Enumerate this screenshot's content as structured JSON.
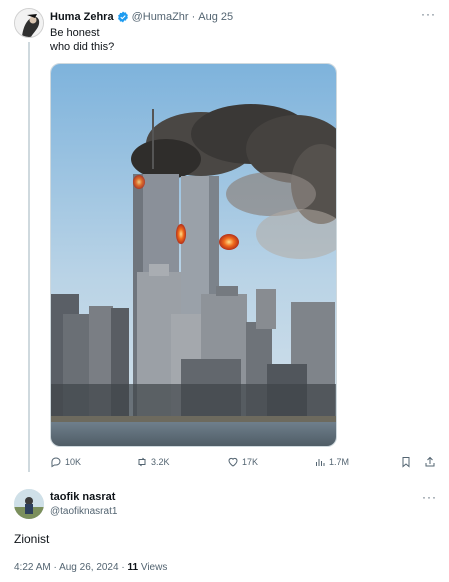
{
  "post": {
    "author_name": "Huma Zehra",
    "author_handle": "@HumaZhr",
    "separator": "·",
    "date": "Aug 25",
    "text_line1": "Be honest",
    "text_line2": "who did this?",
    "more_label": "···",
    "verified_icon": "verified-badge-icon",
    "image_alt": "Photo of the World Trade Center towers with smoke and fire",
    "actions": {
      "replies": "10K",
      "reposts": "3.2K",
      "likes": "17K",
      "views": "1.7M"
    },
    "colors": {
      "accent": "#1d9bf0",
      "muted": "#536471"
    }
  },
  "reply": {
    "author_name": "taofik nasrat",
    "author_handle": "@taofiknasrat1",
    "more_label": "···",
    "text": "Zionist",
    "time": "4:22 AM",
    "separator1": "·",
    "date": "Aug 26, 2024",
    "separator2": "·",
    "views_count": "11",
    "views_label": "Views"
  }
}
